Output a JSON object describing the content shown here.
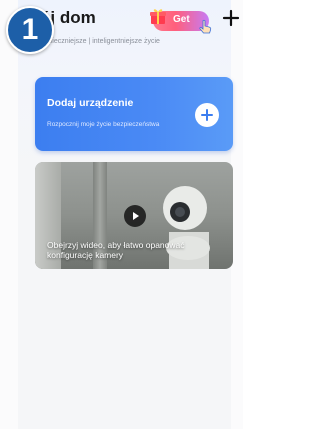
{
  "step_badge": "1",
  "header": {
    "title": "ój dom",
    "subtitle": "ezpieczniejsze | inteligentniejsze życie",
    "get_label": "Get"
  },
  "add_device": {
    "title": "Dodaj urządzenie",
    "subtitle": "Rozpocznij moje życie bezpieczeństwa"
  },
  "video": {
    "caption": "Obejrzyj wideo, aby łatwo opanować konfigurację kamery"
  },
  "colors": {
    "accent": "#4a8af5",
    "badge": "#1d5fa8",
    "get_gradient_start": "#ff7a8e",
    "get_gradient_end": "#c67cf5"
  },
  "icons": {
    "gift": "gift-icon",
    "hand": "hand-pointer-icon",
    "add": "plus-icon",
    "play": "play-icon",
    "camera": "camera-icon"
  }
}
